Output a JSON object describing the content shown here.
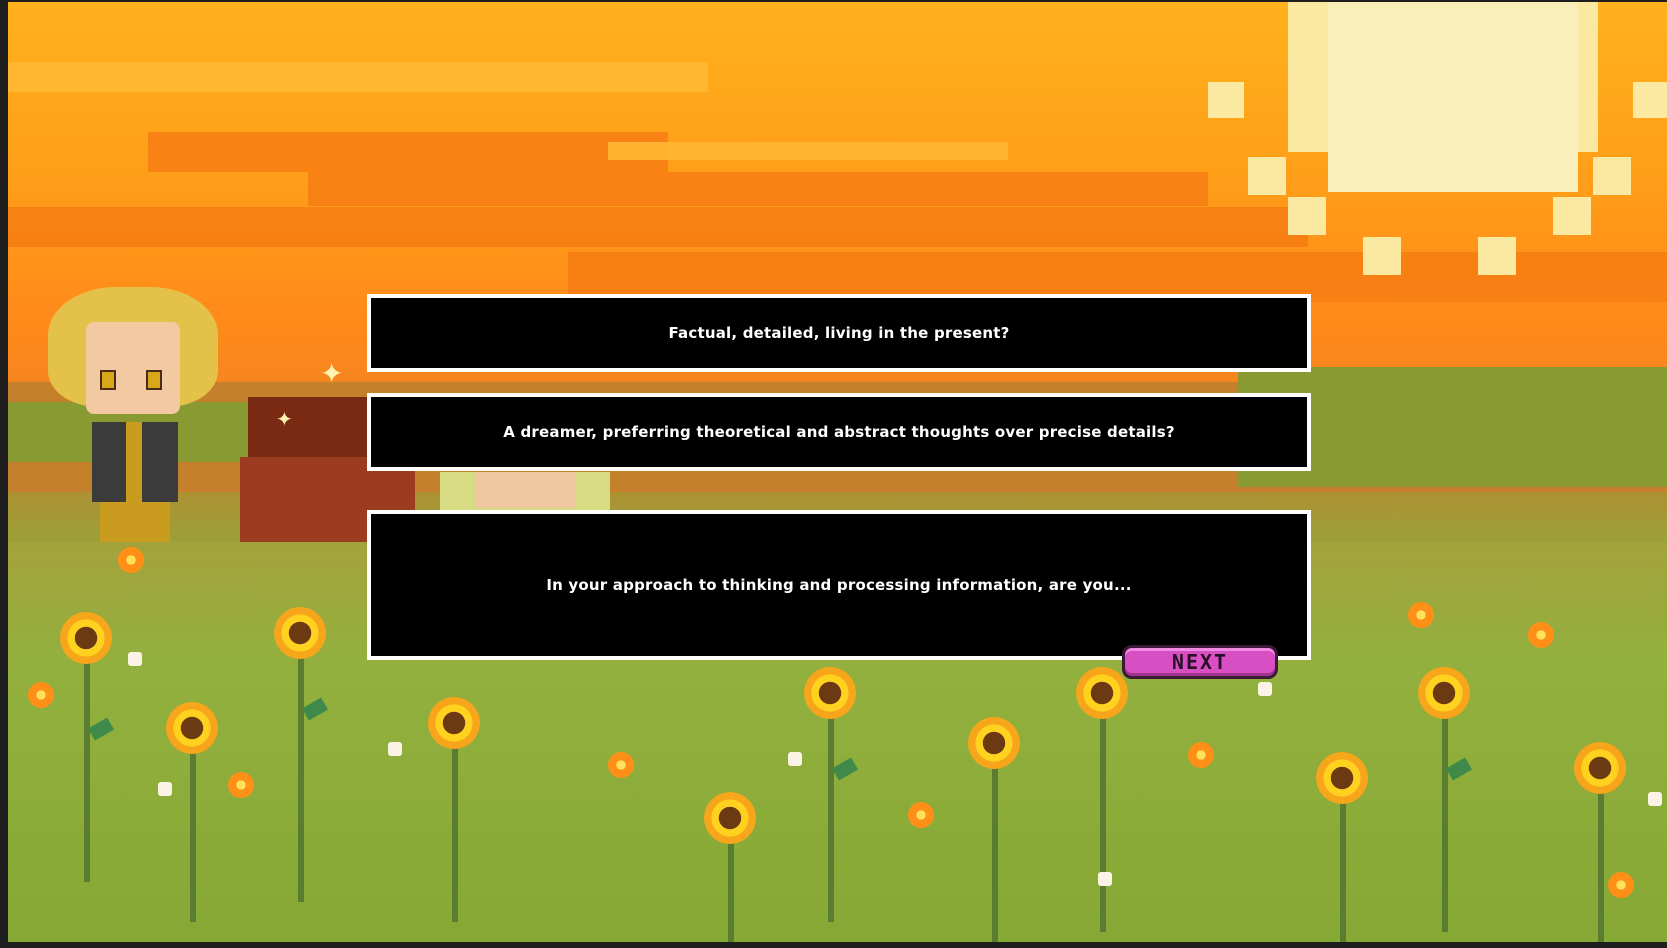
{
  "dialog": {
    "option_1": "Factual, detailed, living in the present?",
    "option_2": "A dreamer, preferring theoretical and abstract thoughts over precise details?",
    "question": "In your approach to thinking and processing information, are you..."
  },
  "buttons": {
    "next_label": "NEXT"
  },
  "colors": {
    "sky": "#ffb11c",
    "next_button": "#d84fc4",
    "dialog_bg": "#000000",
    "dialog_border": "#ffffff"
  }
}
